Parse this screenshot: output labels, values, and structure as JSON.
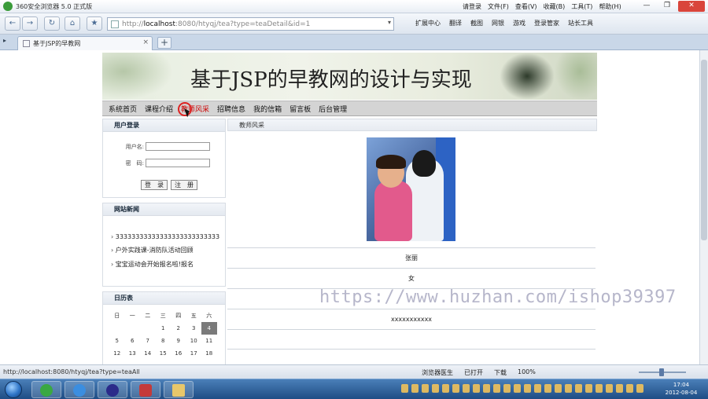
{
  "browser": {
    "title": "360安全浏览器 5.0 正式版",
    "menus": [
      "请登录",
      "文件(F)",
      "查看(V)",
      "收藏(B)",
      "工具(T)",
      "帮助(H)"
    ],
    "window_buttons": [
      "—",
      "❐",
      "✕"
    ],
    "nav_buttons": {
      "back": "←",
      "forward": "→",
      "refresh": "↻",
      "home": "⌂",
      "favorite": "★"
    },
    "address": {
      "proto": "http://",
      "host": "localhost",
      "path": ":8080/htyqj/tea?type=teaDetail&id=1"
    },
    "toolbar_right": [
      "扩展中心",
      "翻译",
      "截图",
      "网银",
      "游戏",
      "登录管家",
      "站长工具"
    ],
    "tab_label": "基于JSP的早教网",
    "status_url": "http://localhost:8080/htyqj/tea?type=teaAll",
    "status_right": [
      "浏览器医生",
      "已打开",
      "下载",
      "100%"
    ]
  },
  "site": {
    "banner_title": "基于JSP的早教网的设计与实现",
    "nav": [
      {
        "label": "系统首页"
      },
      {
        "label": "课程介绍"
      },
      {
        "label": "教师风采"
      },
      {
        "label": "招聘信息"
      },
      {
        "label": "我的信箱"
      },
      {
        "label": "留言板"
      },
      {
        "label": "后台管理"
      }
    ],
    "login": {
      "header": "用户登录",
      "username_label": "用户名:",
      "password_label": "密　码:",
      "login_button": "登　录",
      "register_button": "注　册"
    },
    "news": {
      "header": "网站新闻",
      "items": [
        "33333333333333333333333333",
        "户外实践课-消防队活动回顾",
        "宝宝运动会开始报名啦!报名"
      ]
    },
    "calendar": {
      "header": "日历表",
      "weekdays": [
        "日",
        "一",
        "二",
        "三",
        "四",
        "五",
        "六"
      ],
      "rows": [
        [
          "",
          "",
          "",
          "1",
          "2",
          "3",
          "4"
        ],
        [
          "5",
          "6",
          "7",
          "8",
          "9",
          "10",
          "11"
        ],
        [
          "12",
          "13",
          "14",
          "15",
          "16",
          "17",
          "18"
        ]
      ],
      "today": "4"
    },
    "main": {
      "header": "教师风采",
      "name": "张丽",
      "gender": "女",
      "blank": "",
      "desc": "xxxxxxxxxxx"
    }
  },
  "watermark": "https://www.huzhan.com/ishop39397",
  "taskbar": {
    "clock_time": "17:04",
    "clock_date": "2012-08-04"
  }
}
